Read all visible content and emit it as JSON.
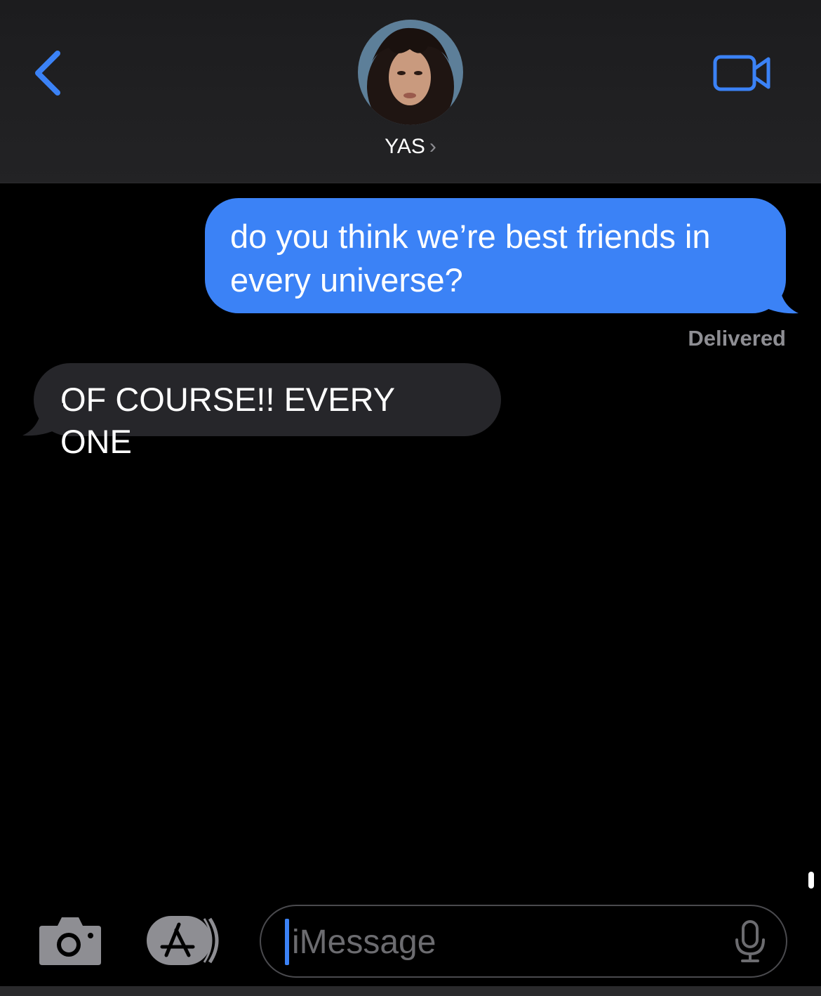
{
  "header": {
    "contact_name": "YAS",
    "name_chevron": "›",
    "back_icon": "chevron-left-icon",
    "video_icon": "video-camera-icon",
    "accent_color": "#3b82f6"
  },
  "messages": [
    {
      "direction": "outgoing",
      "text": "do you think we’re best friends in every universe?",
      "color": "#3b82f6"
    },
    {
      "direction": "incoming",
      "text": "OF COURSE!! EVERY ONE",
      "color": "#26262a"
    }
  ],
  "status": {
    "delivered": "Delivered"
  },
  "composer": {
    "placeholder": "iMessage",
    "camera_icon": "camera-icon",
    "apps_icon": "app-store-icon",
    "mic_icon": "microphone-icon"
  }
}
